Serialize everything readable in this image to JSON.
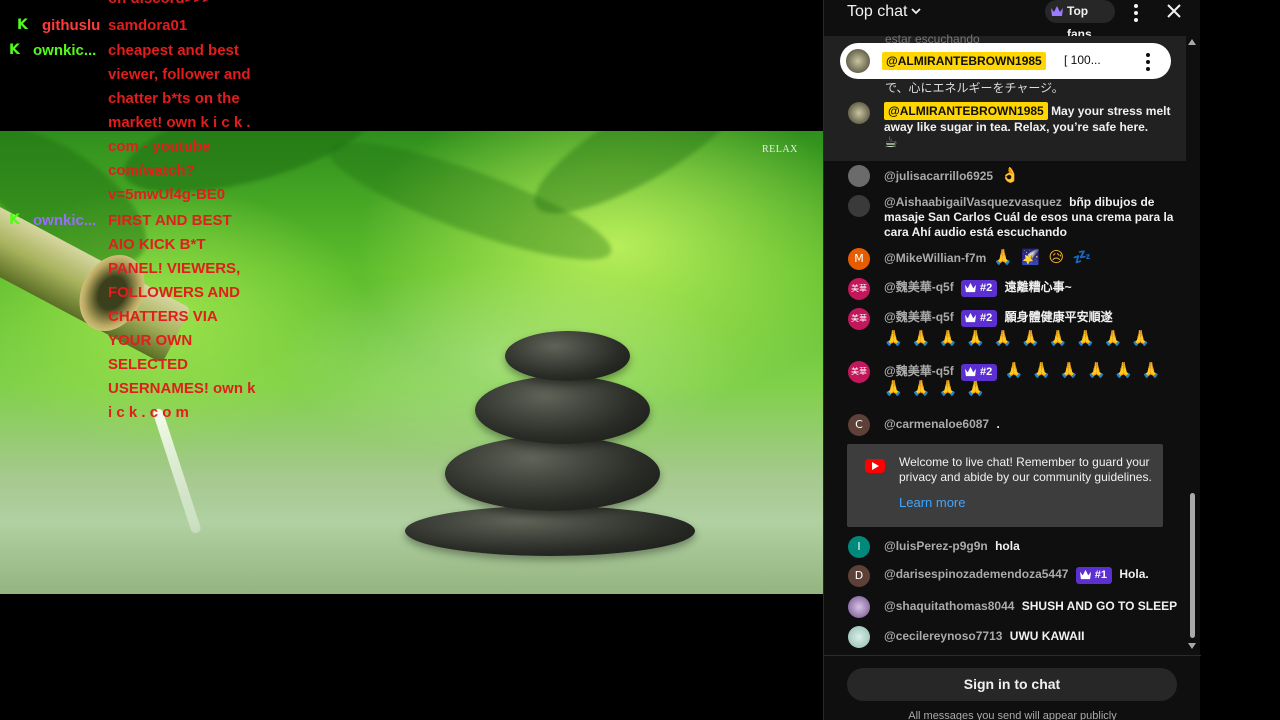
{
  "overlay_chat": {
    "top_partial": "on discord>>>",
    "rows": [
      {
        "user": "githuslu",
        "message": "samdora01"
      },
      {
        "user": "ownkic...",
        "message": "cheapest and best\nviewer, follower and\nchatter b*ts on the\nmarket! own k i c k .\ncom - youtube\ncom/watch?\nv=5mwUl4g-BE0"
      },
      {
        "user": "ownkic...",
        "message": "FIRST AND BEST\nAIO KICK B*T\nPANEL! VIEWERS,\nFOLLOWERS AND\nCHATTERS VIA\nYOUR OWN\nSELECTED\nUSERNAMES! own k\ni c k . c o m"
      }
    ],
    "colors": {
      "kick_green": "#53fc18",
      "message_red": "#e21d1d",
      "user_red": "#ff3b3b",
      "user_purple": "#9b6cff"
    }
  },
  "video": {
    "logo": "RELAX"
  },
  "chat": {
    "title": "Top chat",
    "top_fans_label": "Top fans",
    "pinned": {
      "author": "@ALMIRANTEBROWN1985",
      "preview": "[ 100..."
    },
    "faded_line_1": "estar escuchando",
    "faded_line_2": "で、心にエネルギーをチャージ。",
    "highlight_message": {
      "author": "@ALMIRANTEBROWN1985",
      "text": "May your stress melt away like sugar in tea. Relax, you’re safe here."
    },
    "messages": [
      {
        "author": "@julisacarrillo6925",
        "text": "",
        "emoji": "👌"
      },
      {
        "author": "@AishaabigailVasquezvasquez",
        "text": "bñp dibujos de masaje San Carlos Cuál de esos una crema para la cara Ahí audio está escuchando"
      },
      {
        "author": "@MikeWillian-f7m",
        "text": "",
        "emoji": "🙏 🌠 😥 💤",
        "avatar_letter": "M"
      },
      {
        "author": "@魏美華-q5f",
        "rank": "#2",
        "text": "遠離糟心事~"
      },
      {
        "author": "@魏美華-q5f",
        "rank": "#2",
        "text": "願身體健康平安順遂",
        "emoji": "🙏 🙏 🙏 🙏 🙏 🙏 🙏 🙏 🙏 🙏"
      },
      {
        "author": "@魏美華-q5f",
        "rank": "#2",
        "text": "",
        "emoji": "🙏 🙏 🙏 🙏 🙏 🙏 🙏 🙏 🙏 🙏"
      },
      {
        "author": "@carmenaloe6087",
        "text": ".",
        "avatar_letter": "C"
      },
      {
        "author": "@luisPerez-p9g9n",
        "text": "hola",
        "avatar_letter": "I"
      },
      {
        "author": "@darisespinozademendoza5447",
        "rank": "#1",
        "text": "Hola.",
        "avatar_letter": "D"
      },
      {
        "author": "@shaquitathomas8044",
        "text": "SHUSH AND GO TO SLEEP"
      },
      {
        "author": "@cecilereynoso7713",
        "text": "UWU KAWAII"
      }
    ],
    "avatar_label_chinese": "美華",
    "welcome": {
      "text": "Welcome to live chat! Remember to guard your privacy and abide by our community guidelines.",
      "learn_more": "Learn more"
    },
    "signin_label": "Sign in to chat",
    "footer_note": "All messages you send will appear publicly"
  }
}
